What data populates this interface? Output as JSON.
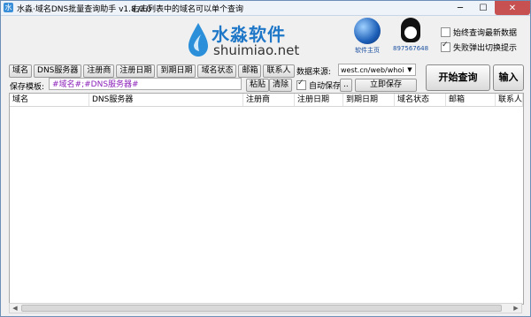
{
  "window": {
    "app_icon_letter": "水",
    "title": "水淼·域名DNS批量查询助手 v1.8.0.0",
    "hint": "右击列表中的域名可以单个查询",
    "minimize_glyph": "─",
    "maximize_glyph": "☐",
    "close_glyph": "✕"
  },
  "logo": {
    "cn": "水淼软件",
    "en": "shuimiao.net"
  },
  "homepage": {
    "label": "软件主页"
  },
  "qq": {
    "number": "897567648"
  },
  "options": {
    "always_latest": {
      "label": "始终查询最新数据",
      "checked": false
    },
    "popup_on_fail": {
      "label": "失败弹出切换提示",
      "checked": true
    }
  },
  "toolbar": {
    "fields": [
      "域名",
      "DNS服务器",
      "注册商",
      "注册日期",
      "到期日期",
      "域名状态",
      "邮箱",
      "联系人"
    ]
  },
  "template": {
    "label": "保存模板:",
    "value": "#域名#;#DNS服务器#",
    "paste": "粘贴",
    "clear": "清除"
  },
  "source": {
    "label": "数据来源:",
    "selected": "west.cn/web/whoi",
    "arrow": "▼"
  },
  "autosave": {
    "label": "自动保存",
    "checked": true,
    "dots": "..",
    "save_now": "立即保存"
  },
  "actions": {
    "start_query": "开始查询",
    "input": "输入"
  },
  "grid": {
    "columns": [
      "域名",
      "DNS服务器",
      "注册商",
      "注册日期",
      "到期日期",
      "域名状态",
      "邮箱",
      "联系人"
    ],
    "rows": []
  },
  "scrollbar": {
    "left": "◀",
    "right": "▶"
  }
}
